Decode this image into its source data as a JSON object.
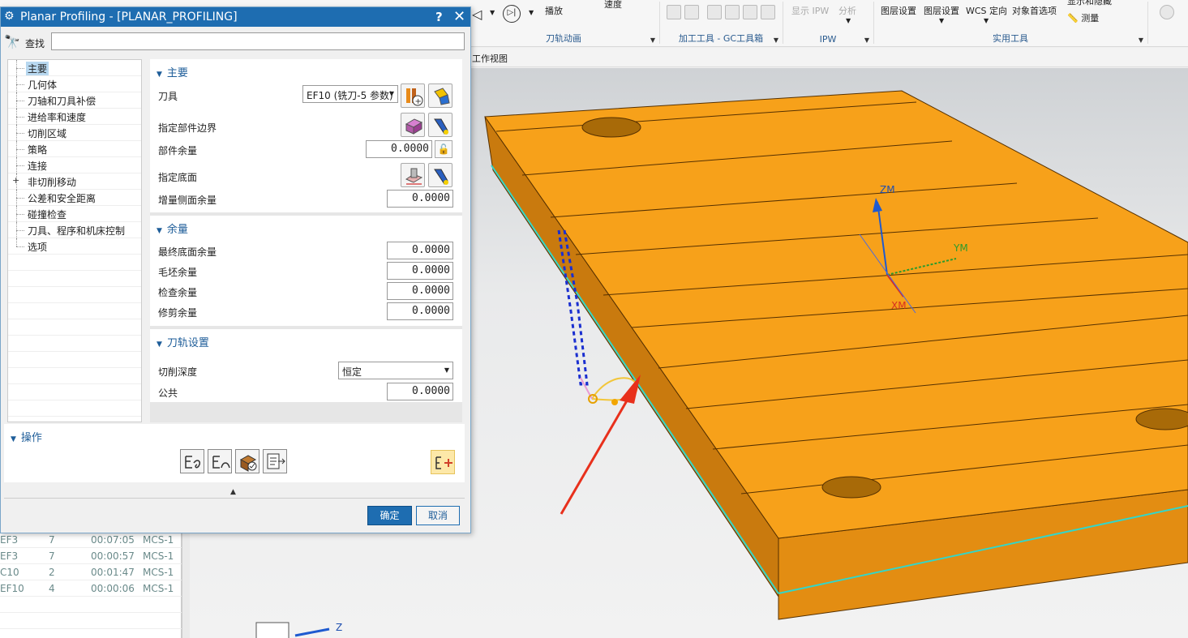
{
  "dialog": {
    "title": "Planar Profiling - [PLANAR_PROFILING]",
    "help": "?",
    "close": "✕",
    "find_label": "查找",
    "find_value": "",
    "ok": "确定",
    "cancel": "取消"
  },
  "tree": {
    "items": [
      "主要",
      "几何体",
      "刀轴和刀具补偿",
      "进给率和速度",
      "切削区域",
      "策略",
      "连接",
      "非切削移动",
      "公差和安全距离",
      "碰撞检查",
      "刀具、程序和机床控制",
      "选项"
    ],
    "expandable_marker": "+"
  },
  "main_section": {
    "title": "主要",
    "tool_label": "刀具",
    "tool_value": "EF10 (铣刀-5 参数)",
    "part_boundary_label": "指定部件边界",
    "part_stock_label": "部件余量",
    "part_stock_value": "0.0000",
    "floor_label": "指定底面",
    "side_stock_label": "增量侧面余量",
    "side_stock_value": "0.0000"
  },
  "stock_section": {
    "title": "余量",
    "fields": [
      {
        "label": "最终底面余量",
        "value": "0.0000"
      },
      {
        "label": "毛坯余量",
        "value": "0.0000"
      },
      {
        "label": "检查余量",
        "value": "0.0000"
      },
      {
        "label": "修剪余量",
        "value": "0.0000"
      }
    ]
  },
  "path_section": {
    "title": "刀轨设置",
    "depth_label": "切削深度",
    "depth_value": "恒定",
    "common_label": "公共",
    "common_value": "0.0000"
  },
  "operations": {
    "title": "操作"
  },
  "ribbon": {
    "play_label": "播放",
    "speed_label": "速度",
    "group_animation": "刀轨动画",
    "group_tools": "加工工具 - GC工具箱",
    "ipw_show": "显示 IPW",
    "analysis": "分析",
    "group_ipw": "IPW",
    "layer_settings": "图层设置",
    "layer_settings2": "图层设置",
    "wcs_orient": "WCS 定向",
    "object_prefs": "对象首选项",
    "measure": "测量",
    "show_hide": "显示和隐藏",
    "group_utility": "实用工具"
  },
  "subbar_label": "工作视图",
  "navigator": {
    "rows": [
      {
        "tool": "EF3",
        "n": "7",
        "time": "00:07:05",
        "mcs": "MCS-1"
      },
      {
        "tool": "EF3",
        "n": "7",
        "time": "00:00:57",
        "mcs": "MCS-1"
      },
      {
        "tool": "C10",
        "n": "2",
        "time": "00:01:47",
        "mcs": "MCS-1"
      },
      {
        "tool": "EF10",
        "n": "4",
        "time": "00:00:06",
        "mcs": "MCS-1"
      }
    ]
  },
  "viewport": {
    "axis_z": "ZM",
    "axis_y": "YM",
    "axis_x": "XM",
    "triad_z": "Z",
    "part_color": "#f7a11a",
    "path_color": "#1a2fd0",
    "arrow_color": "#e8301c"
  }
}
